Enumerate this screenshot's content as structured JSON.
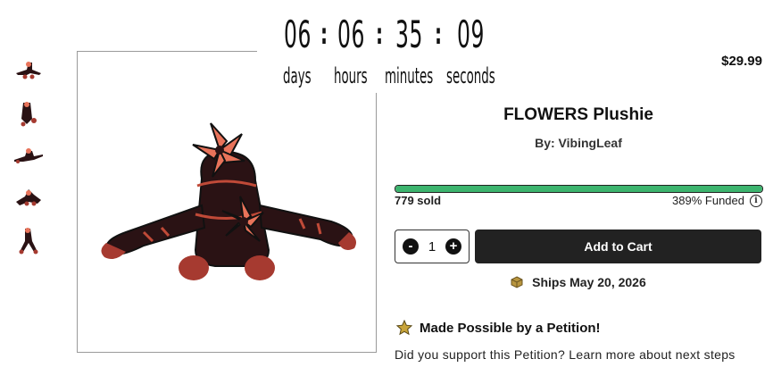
{
  "countdown": {
    "days": "06",
    "hours": "06",
    "minutes": "35",
    "seconds": "09",
    "separator": ":",
    "labels": {
      "days": "days",
      "hours": "hours",
      "minutes": "minutes",
      "seconds": "seconds"
    }
  },
  "product": {
    "price": "$29.99",
    "title": "FLOWERS Plushie",
    "creator": "By: VibingLeaf",
    "sold": "779 sold",
    "funded": "389% Funded",
    "funded_fraction": 1.0,
    "quantity": "1",
    "minus_label": "-",
    "plus_label": "+",
    "cart_label": "Add to Cart",
    "ships": "Ships May 20, 2026",
    "info_glyph": "i"
  },
  "petition": {
    "heading": "Made Possible by a Petition!",
    "text": "Did you support this Petition? Learn more about next steps"
  },
  "icons": {
    "thumb_images": [
      "plushie-front",
      "plushie-side",
      "plushie-back",
      "plushie-top",
      "plushie-standing"
    ],
    "ships_icon": "box-icon",
    "petition_icon": "star-icon",
    "info_icon": "info-icon"
  },
  "colors": {
    "progress": "#3cb46e",
    "cart": "#222222",
    "plush_body": "#2a1214",
    "plush_accent": "#e8735a",
    "plush_paw": "#a63a30",
    "star": "#c8a43a",
    "box": "#b8953e"
  }
}
